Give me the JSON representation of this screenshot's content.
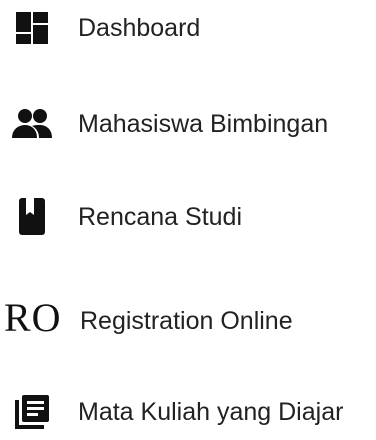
{
  "sidebar": {
    "items": [
      {
        "label": "Dashboard",
        "icon": "dashboard-icon"
      },
      {
        "label": "Mahasiswa Bimbingan",
        "icon": "people-icon"
      },
      {
        "label": "Rencana Studi",
        "icon": "book-icon"
      },
      {
        "label": "Registration Online",
        "icon_text": "RO"
      },
      {
        "label": "Mata Kuliah yang Diajar",
        "icon": "library-books-icon"
      }
    ]
  },
  "colors": {
    "icon": "#111111",
    "text": "#222222",
    "background": "#ffffff"
  }
}
